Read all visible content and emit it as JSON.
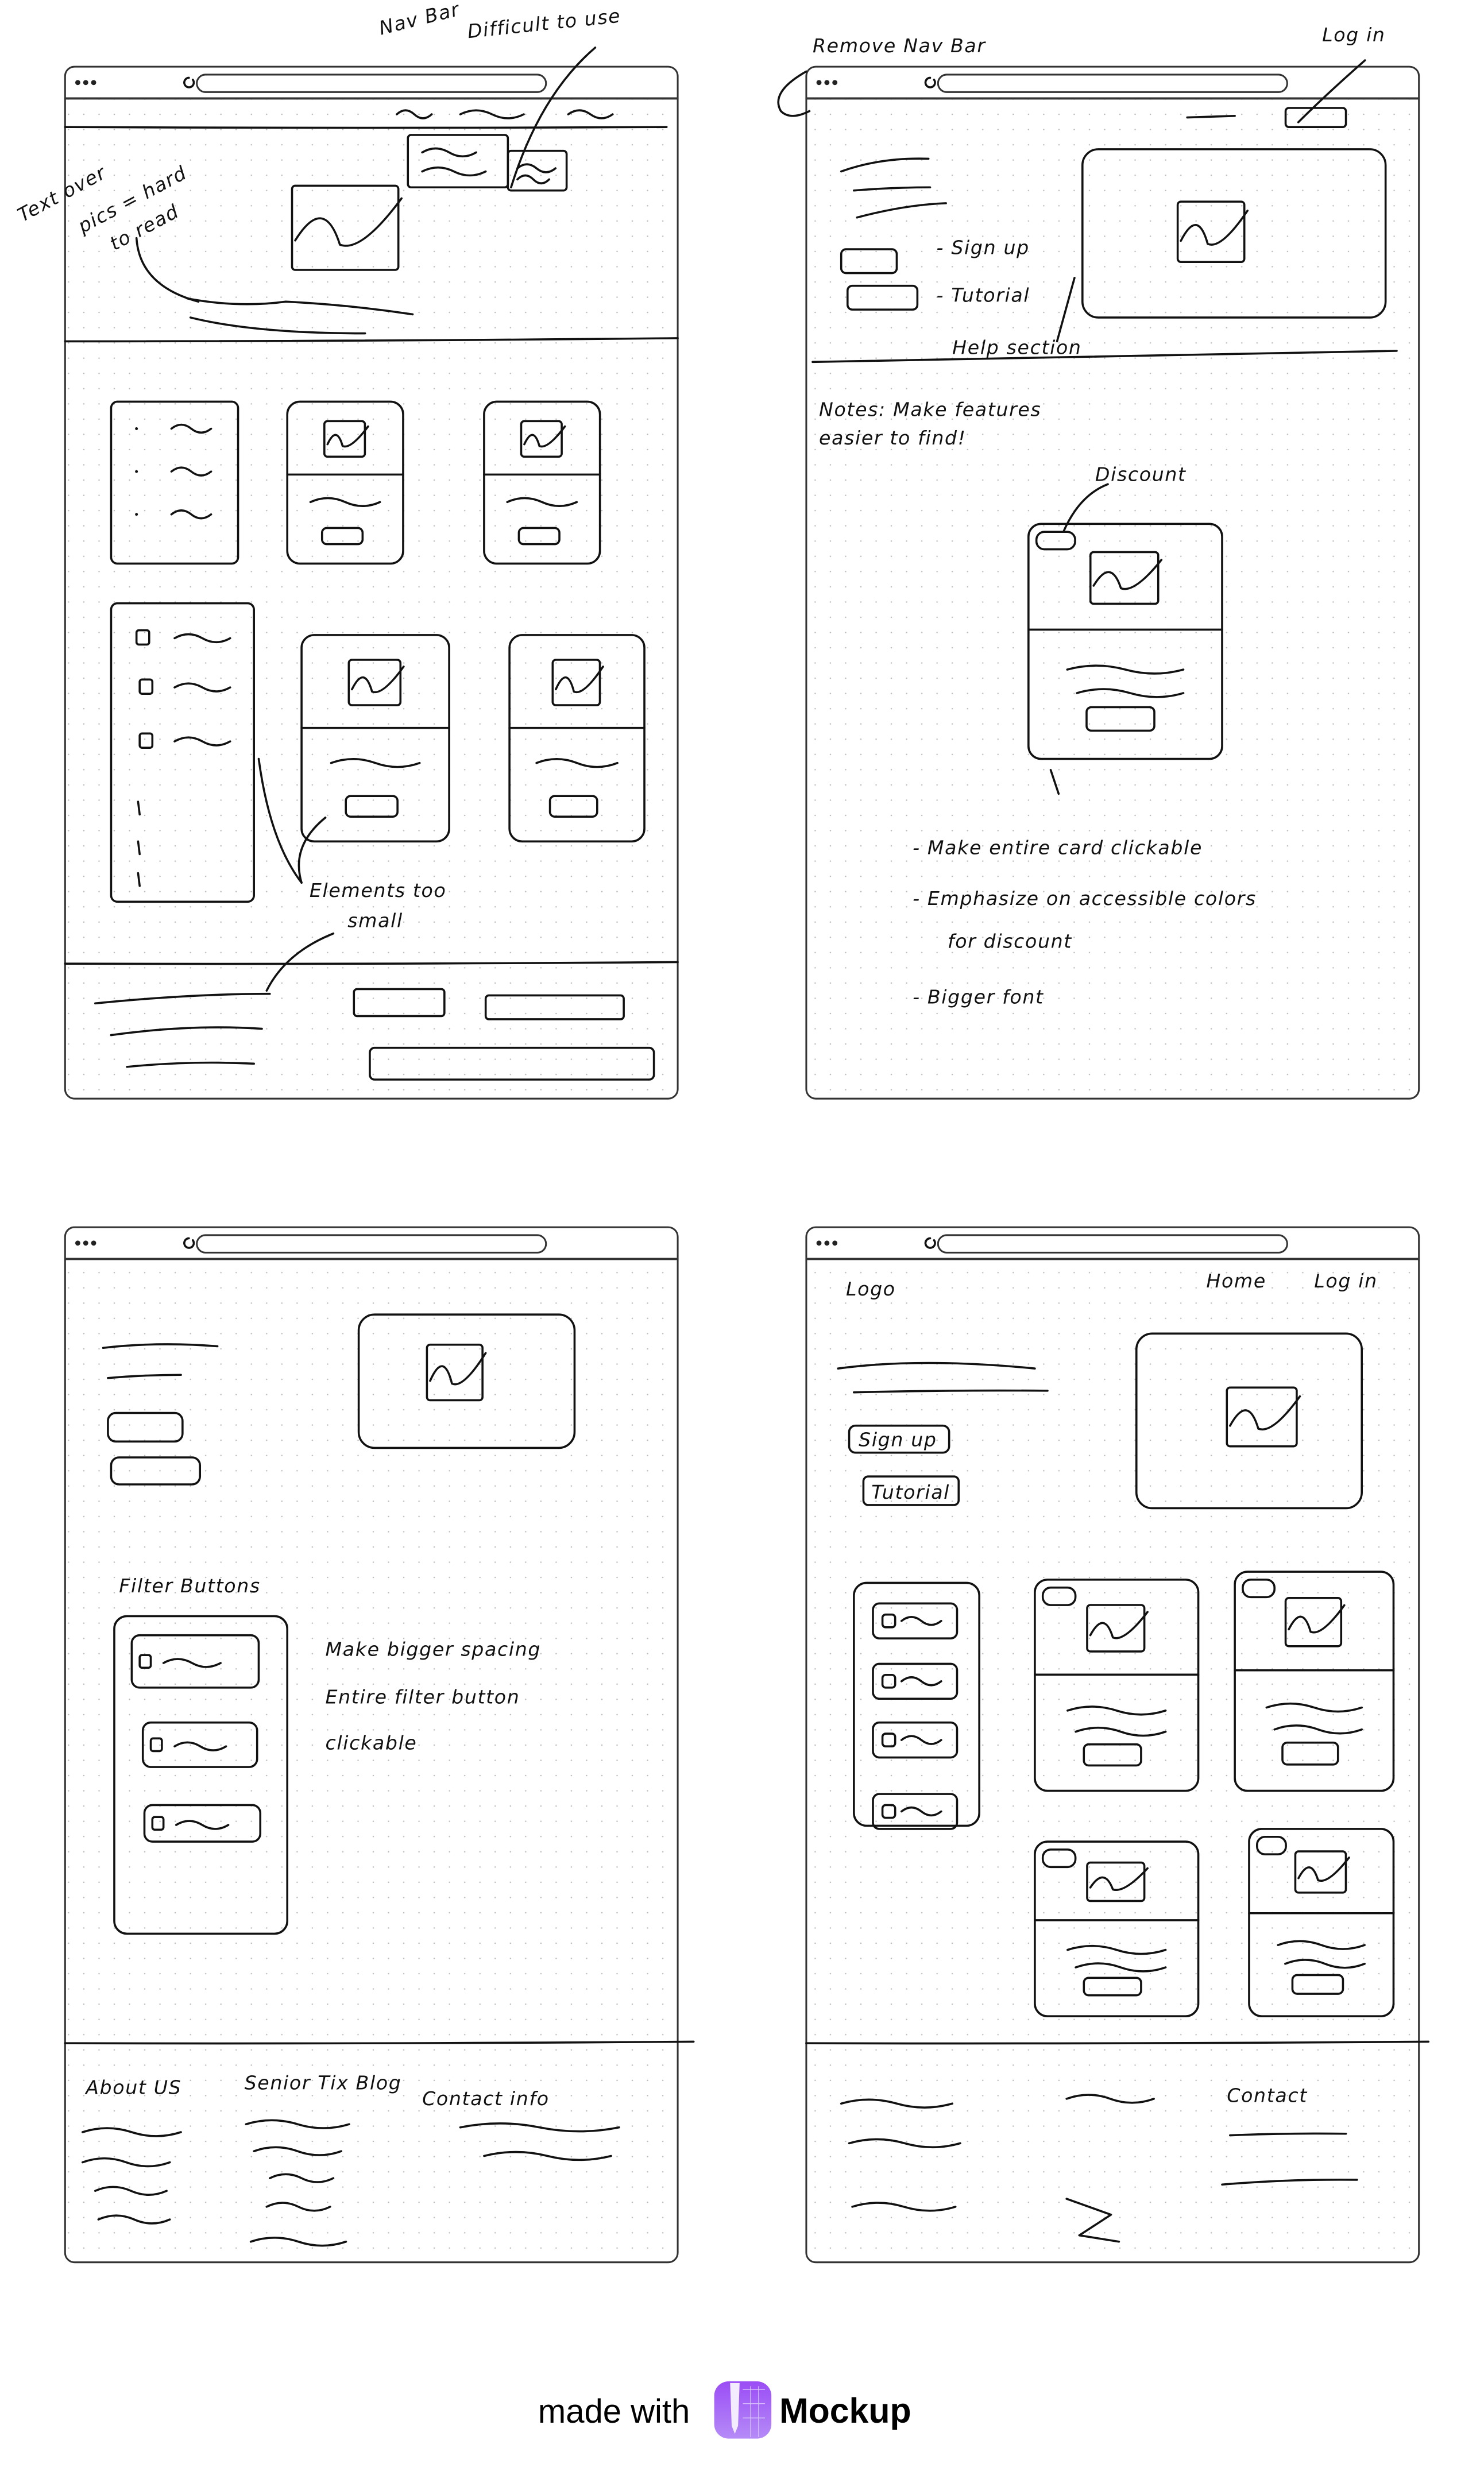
{
  "branding": {
    "made_with": "made with",
    "product": "Mockup",
    "logo_color": "#9B5CF6"
  },
  "frames": [
    {
      "annotations": {
        "nav_bar": "Nav Bar",
        "difficult": "Difficult to use",
        "text_over": "Text over",
        "pics_hard": "pics = hard",
        "to_read": "to read",
        "elements_too": "Elements too",
        "small": "small"
      }
    },
    {
      "annotations": {
        "remove_nav": "Remove Nav Bar",
        "log_in": "Log in",
        "sign_up": "- Sign up",
        "tutorial": "- Tutorial",
        "help": "Help section",
        "notes1": "Notes: Make features",
        "notes2": "easier to find!",
        "discount": "Discount"
      },
      "notes": [
        "- Make entire card clickable",
        "- Emphasize on accessible colors",
        "for discount",
        "- Bigger font"
      ]
    },
    {
      "annotations": {
        "filter_buttons": "Filter Buttons",
        "spacing": "Make bigger spacing",
        "entire": "Entire filter button",
        "clickable": "clickable"
      },
      "footer": {
        "about": "About US",
        "blog": "Senior Tix Blog",
        "contact": "Contact info"
      }
    },
    {
      "nav": {
        "logo": "Logo",
        "home": "Home",
        "login": "Log in"
      },
      "hero": {
        "sign_up": "Sign up",
        "tutorial": "Tutorial"
      },
      "footer": {
        "contact": "Contact"
      }
    }
  ]
}
